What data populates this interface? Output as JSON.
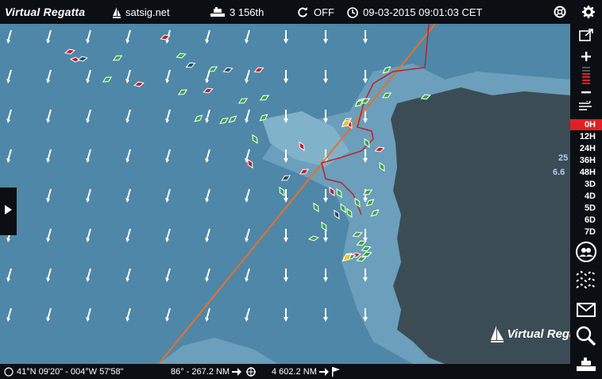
{
  "topbar": {
    "logo": "Virtual Regatta",
    "site": "satsig.net",
    "ranking": "3 156th",
    "sync_status": "OFF",
    "datetime": "09-03-2015 09:01:03 CET"
  },
  "rail": {
    "time_steps": [
      "0H",
      "12H",
      "24H",
      "36H",
      "48H",
      "3D",
      "4D",
      "5D",
      "6D",
      "7D"
    ],
    "active_step": "0H"
  },
  "wind_overlay": {
    "line1": "25",
    "line2": "6.6"
  },
  "bottombar": {
    "position": "41°N 09'20\" - 004°W 57'58\"",
    "bearing": "86° - 267.2 NM",
    "distance_to_finish": "4 602.2 NM"
  },
  "watermark": {
    "text": "Virtual Regatta"
  },
  "colors": {
    "sea": "#4f87a8",
    "shallow": "#6aa0bb",
    "land": "#3c4c55",
    "track": "#e8702a",
    "route": "#c0202a",
    "boat_green": "#3aa83a",
    "boat_red": "#c0202a",
    "boat_dark": "#2b4a5c",
    "bar": "#0b0f14",
    "active_step": "#e02020"
  }
}
